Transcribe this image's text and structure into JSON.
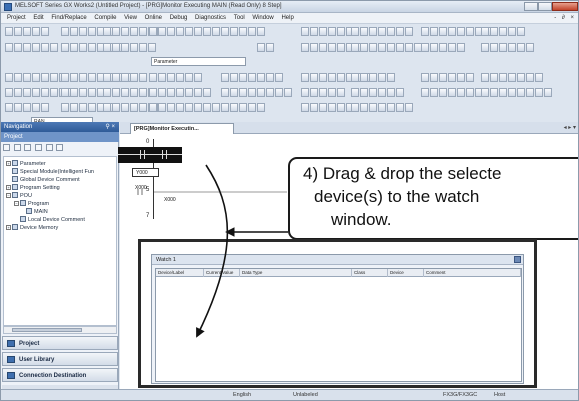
{
  "window": {
    "title": "MELSOFT Series GX Works2 (Untitled Project) - [PRG]Monitor Executing MAIN (Read Only) 8 Step]"
  },
  "menubar": {
    "items": [
      "Project",
      "Edit",
      "Find/Replace",
      "Compile",
      "View",
      "Online",
      "Debug",
      "Diagnostics",
      "Tool",
      "Window",
      "Help"
    ],
    "mdi_controls": "- ∂ ×"
  },
  "toolbar": {
    "parameter_combo": "Parameter",
    "station_combo": "RAN"
  },
  "navigator": {
    "title": "Navigation",
    "pin": "⚲ ×",
    "project_label": "Project",
    "tree": [
      "Parameter",
      "Special Module(Intelligent Fun",
      "Global Device Comment",
      "Program Setting",
      "POU",
      "Program",
      "MAIN",
      "Local Device Comment",
      "Device Memory"
    ],
    "tabs": [
      "Project",
      "User Library",
      "Connection Destination"
    ]
  },
  "document": {
    "tab_label": "[PRG]Monitor Executin...",
    "tab_nav": "◂ ▸ ▾",
    "steps": [
      "0",
      "5",
      "7"
    ],
    "devices": [
      "X000",
      "X000"
    ],
    "contact_label": "Y000"
  },
  "callout": {
    "line1": "4) Drag & drop the selecte",
    "line2": "device(s) to the watch",
    "line3": "window."
  },
  "watch": {
    "title": "Watch 1",
    "columns": [
      "Device/Label",
      "Current Value",
      "Data Type",
      "Class",
      "Device",
      "Comment"
    ]
  },
  "statusbar": {
    "language": "English",
    "label_state": "Unlabeled",
    "cpu": "FX3G/FX3GC",
    "host": "Host"
  }
}
